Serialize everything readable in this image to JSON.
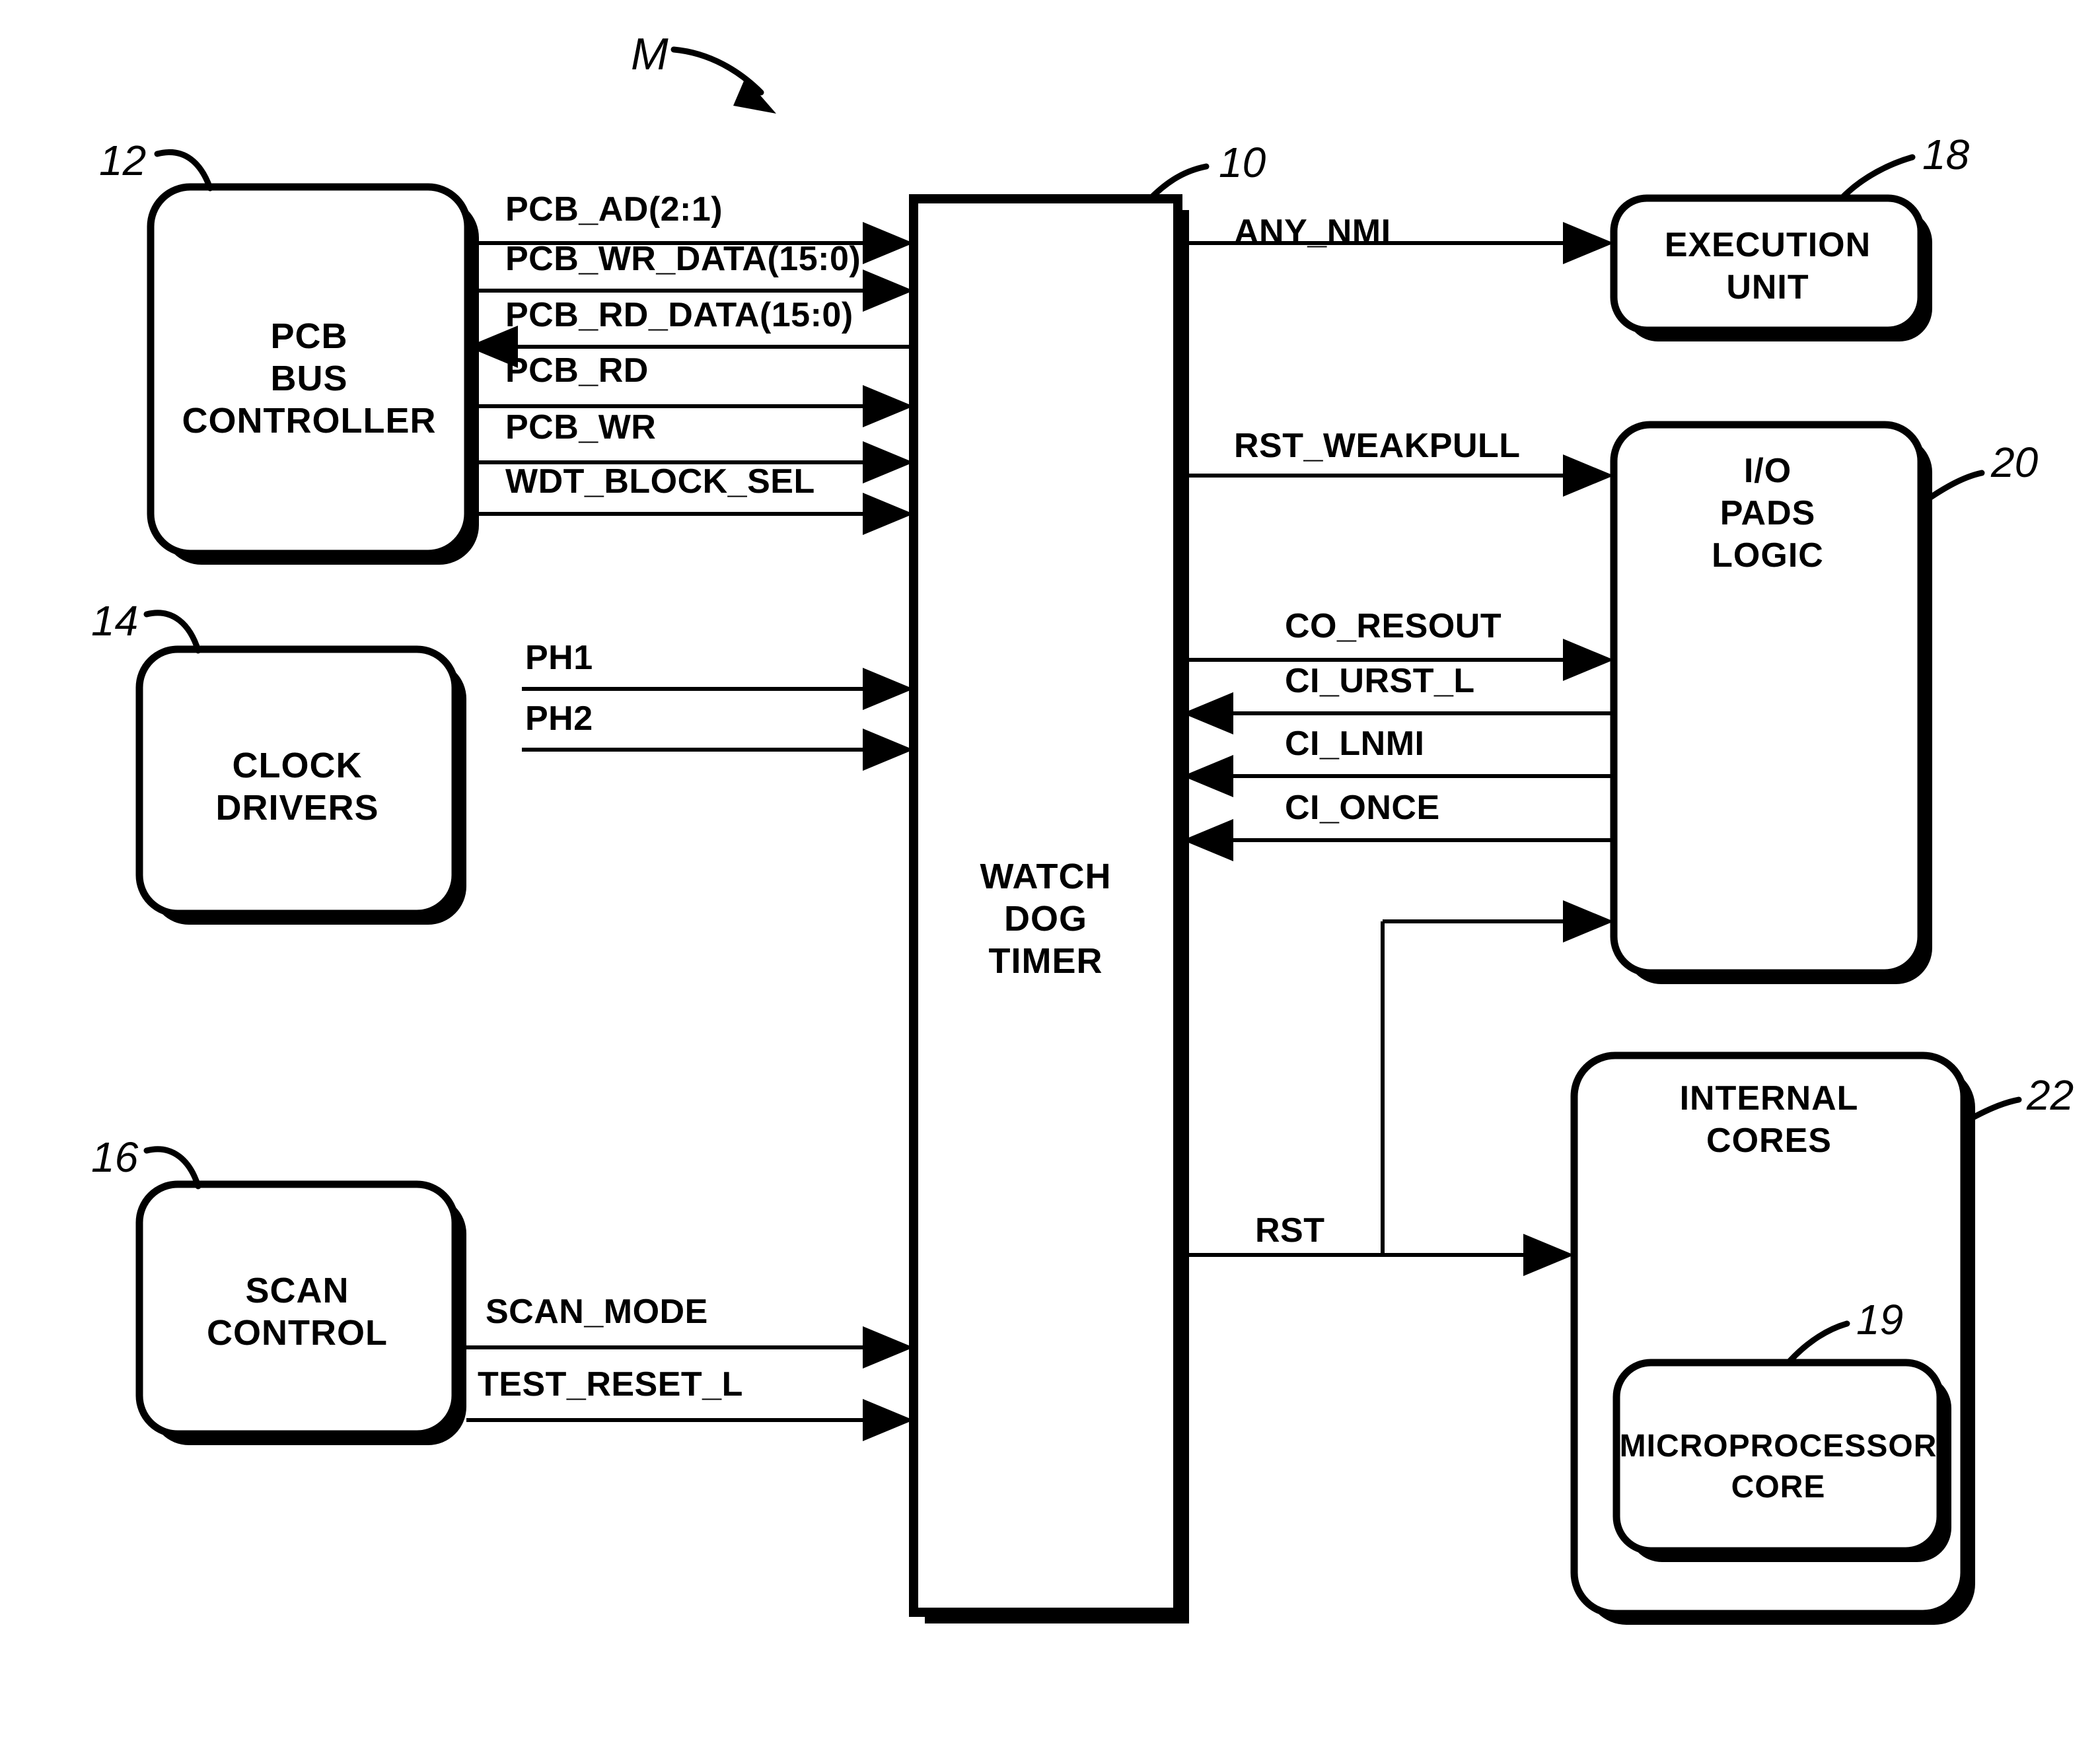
{
  "figure": {
    "system_marker": "M",
    "blocks": [
      {
        "id": "pcb-bus-controller",
        "ref": "12",
        "lines": [
          "PCB",
          "BUS",
          "CONTROLLER"
        ]
      },
      {
        "id": "clock-drivers",
        "ref": "14",
        "lines": [
          "CLOCK",
          "DRIVERS"
        ]
      },
      {
        "id": "scan-control",
        "ref": "16",
        "lines": [
          "SCAN",
          "CONTROL"
        ]
      },
      {
        "id": "watchdog-timer",
        "ref": "10",
        "lines": [
          "WATCH",
          "DOG",
          "TIMER"
        ]
      },
      {
        "id": "execution-unit",
        "ref": "18",
        "lines": [
          "EXECUTION",
          "UNIT"
        ]
      },
      {
        "id": "io-pads-logic",
        "ref": "20",
        "lines": [
          "I/O",
          "PADS",
          "LOGIC"
        ]
      },
      {
        "id": "internal-cores",
        "ref": "22",
        "lines": [
          "INTERNAL",
          "CORES"
        ]
      },
      {
        "id": "microprocessor-core",
        "ref": "19",
        "lines": [
          "MICROPROCESSOR",
          "CORE"
        ]
      }
    ],
    "signals": {
      "bus_controller_to_wdt": [
        {
          "name": "PCB_AD(2:1)",
          "direction": "to-wdt"
        },
        {
          "name": "PCB_WR_DATA(15:0)",
          "direction": "to-wdt"
        },
        {
          "name": "PCB_RD_DATA(15:0)",
          "direction": "from-wdt"
        },
        {
          "name": "PCB_RD",
          "direction": "to-wdt"
        },
        {
          "name": "PCB_WR",
          "direction": "to-wdt"
        },
        {
          "name": "WDT_BLOCK_SEL",
          "direction": "to-wdt"
        }
      ],
      "clock_to_wdt": [
        {
          "name": "PH1",
          "direction": "to-wdt"
        },
        {
          "name": "PH2",
          "direction": "to-wdt"
        }
      ],
      "scan_to_wdt": [
        {
          "name": "SCAN_MODE",
          "direction": "to-wdt"
        },
        {
          "name": "TEST_RESET_L",
          "direction": "to-wdt"
        }
      ],
      "wdt_to_execution_unit": [
        {
          "name": "ANY_NMI",
          "direction": "from-wdt"
        }
      ],
      "wdt_to_io_pads": [
        {
          "name": "RST_WEAKPULL",
          "direction": "from-wdt"
        },
        {
          "name": "CO_RESOUT",
          "direction": "from-wdt"
        },
        {
          "name": "CI_URST_L",
          "direction": "to-wdt"
        },
        {
          "name": "CI_LNMI",
          "direction": "to-wdt"
        },
        {
          "name": "CI_ONCE",
          "direction": "to-wdt"
        }
      ],
      "wdt_to_internal_cores": [
        {
          "name": "RST",
          "direction": "from-wdt"
        }
      ]
    },
    "colors": {
      "ink": "#000000",
      "paper": "#ffffff"
    }
  }
}
